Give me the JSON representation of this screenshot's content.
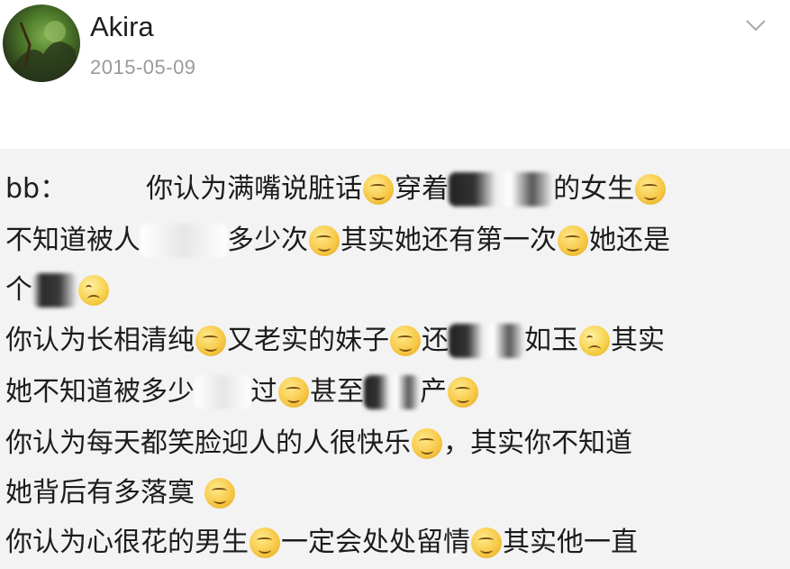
{
  "post": {
    "username": "Akira",
    "date": "2015-05-09"
  },
  "lines": [
    {
      "a": "bb：",
      "b": "你认为满嘴说脏话",
      "c": "穿着",
      "d": "的女生"
    },
    {
      "a": "不知道被人",
      "b": "多少次",
      "c": "其实她还有第一次",
      "d": "她还是"
    },
    {
      "a": "个"
    },
    {
      "a": "你认为长相清纯",
      "b": "又老实的妹子",
      "c": "还",
      "d": "如玉",
      "e": "其实"
    },
    {
      "a": "她不知道被多少",
      "b": "过",
      "c": "甚至",
      "d": "产"
    },
    {
      "a": "你认为每天都笑脸迎人的人很快乐",
      "b": "，其实你不知道"
    },
    {
      "a": "她背后有多落寞"
    },
    {
      "a": "你认为心很花的男生",
      "b": "一定会处处留情",
      "c": "其实他一直"
    }
  ],
  "icons": {
    "more": "chevron-down-icon",
    "emoji": "thinking-face-icon"
  }
}
